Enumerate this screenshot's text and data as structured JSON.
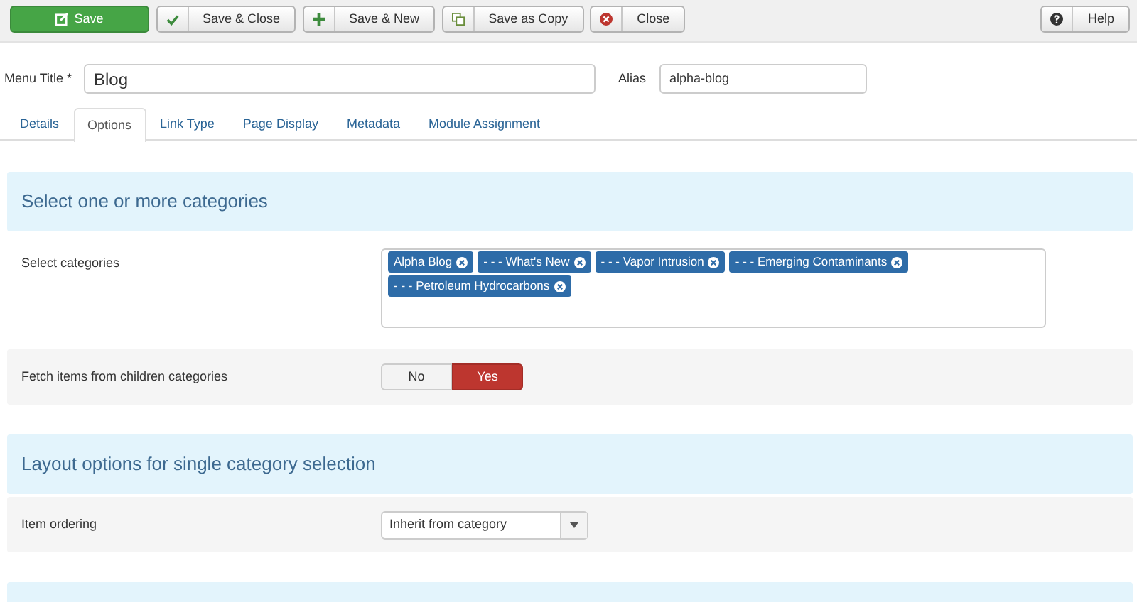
{
  "toolbar": {
    "buttons": [
      {
        "label": "Save",
        "kind": "save"
      },
      {
        "label": "Save & Close",
        "kind": "save-close"
      },
      {
        "label": "Save & New",
        "kind": "save-new"
      },
      {
        "label": "Save as Copy",
        "kind": "copy"
      },
      {
        "label": "Close",
        "kind": "close"
      }
    ],
    "help": {
      "label": "Help",
      "kind": "help"
    }
  },
  "menu_title": {
    "label": "Menu Title *",
    "value": "Blog"
  },
  "alias": {
    "label": "Alias",
    "value": "alpha-blog"
  },
  "tabs": [
    {
      "label": "Details",
      "selected": false
    },
    {
      "label": "Options",
      "selected": true
    },
    {
      "label": "Link Type",
      "selected": false
    },
    {
      "label": "Page Display",
      "selected": false
    },
    {
      "label": "Metadata",
      "selected": false
    },
    {
      "label": "Module Assignment",
      "selected": false
    }
  ],
  "sections": [
    {
      "title": "Select one or more categories",
      "rows": [
        {
          "kind": "tags",
          "label": "Select categories",
          "tags": [
            "Alpha Blog",
            "- - - What's New",
            "- - - Vapor Intrusion",
            "- - - Emerging Contaminants",
            "- - - Petroleum Hydrocarbons"
          ]
        },
        {
          "kind": "toggle",
          "label": "Fetch items from children categories",
          "options": [
            {
              "label": "No",
              "selected": false
            },
            {
              "label": "Yes",
              "selected": true
            }
          ]
        }
      ]
    },
    {
      "title": "Layout options for single category selection",
      "rows": [
        {
          "kind": "select",
          "label": "Item ordering",
          "value": "Inherit from category"
        }
      ]
    }
  ]
}
